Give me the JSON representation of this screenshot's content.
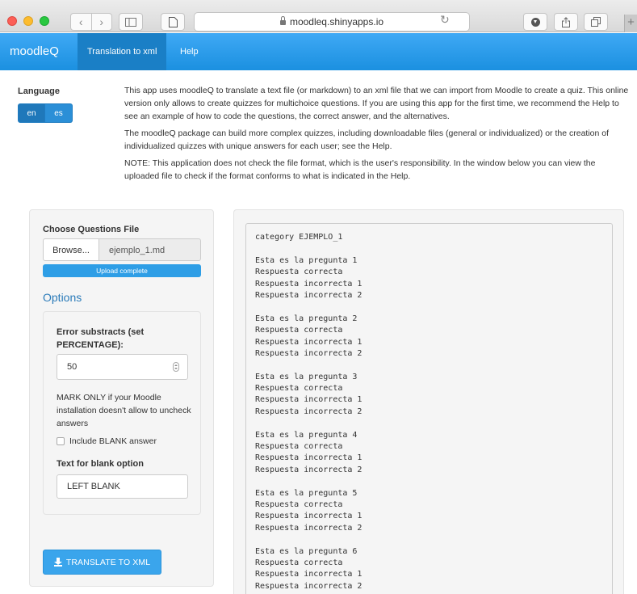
{
  "browser": {
    "url": "moodleq.shinyapps.io",
    "icons": [
      "back-arrow",
      "forward-arrow",
      "sidebar",
      "page",
      "lock",
      "reload",
      "download",
      "share",
      "tabs",
      "plus"
    ]
  },
  "navbar": {
    "brand": "moodleQ",
    "tabs": [
      {
        "label": "Translation to xml",
        "active": true
      },
      {
        "label": "Help",
        "active": false
      }
    ],
    "color": "#2196e8"
  },
  "language": {
    "label": "Language",
    "options": [
      "en",
      "es"
    ],
    "selected": "en"
  },
  "intro": {
    "p1": "This app uses moodleQ to translate a text file (or markdown) to an xml file that we can import from Moodle to create a quiz. This online version only allows to create quizzes for multichoice questions. If you are using this app for the first time, we recommend the Help to see an example of how to code the questions, the correct answer, and the alternatives.",
    "p2": "The moodleQ package can build more complex quizzes, including downloadable files (general or individualized) or the creation of individualized quizzes with unique answers for each user; see the Help.",
    "p3": "NOTE: This application does not check the file format, which is the user's responsibility. In the window below you can view the uploaded file to check if the format conforms to what is indicated in the Help."
  },
  "sidebar": {
    "file_label": "Choose Questions File",
    "browse_label": "Browse...",
    "file_name": "ejemplo_1.md",
    "upload_status": "Upload complete",
    "upload_progress": 1.0,
    "options_title": "Options",
    "error_label": "Error substracts (set PERCENTAGE):",
    "error_value": "50",
    "mark_text": "MARK ONLY if your Moodle installation doesn't allow to uncheck answers",
    "blank_checkbox_label": "Include BLANK answer",
    "blank_checked": false,
    "blank_text_label": "Text for blank option",
    "blank_text_value": "LEFT BLANK",
    "translate_button": "TRANSLATE TO XML"
  },
  "file_preview": {
    "lines": [
      "category EJEMPLO_1",
      "",
      "Esta es la pregunta 1",
      "Respuesta correcta",
      "Respuesta incorrecta 1",
      "Respuesta incorrecta 2",
      "",
      "Esta es la pregunta 2",
      "Respuesta correcta",
      "Respuesta incorrecta 1",
      "Respuesta incorrecta 2",
      "",
      "Esta es la pregunta 3",
      "Respuesta correcta",
      "Respuesta incorrecta 1",
      "Respuesta incorrecta 2",
      "",
      "Esta es la pregunta 4",
      "Respuesta correcta",
      "Respuesta incorrecta 1",
      "Respuesta incorrecta 2",
      "",
      "Esta es la pregunta 5",
      "Respuesta correcta",
      "Respuesta incorrecta 1",
      "Respuesta incorrecta 2",
      "",
      "Esta es la pregunta 6",
      "Respuesta correcta",
      "Respuesta incorrecta 1",
      "Respuesta incorrecta 2"
    ]
  }
}
